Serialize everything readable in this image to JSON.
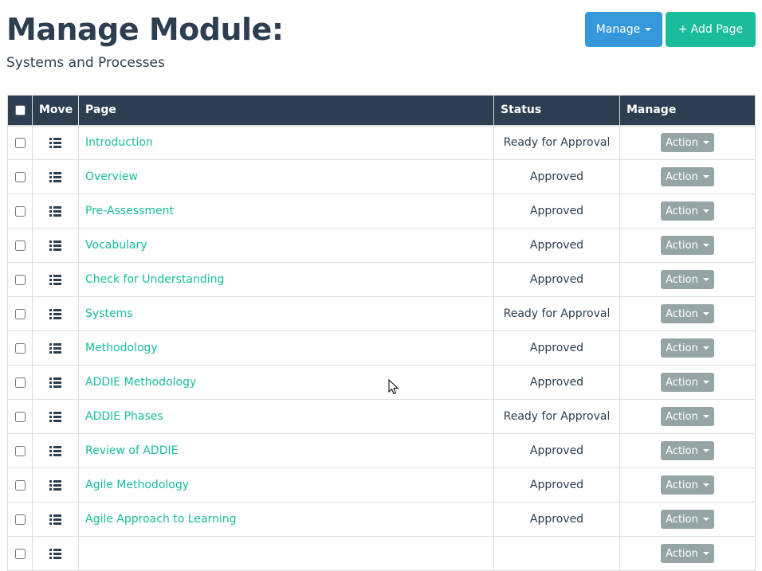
{
  "header": {
    "title": "Manage Module:",
    "subtitle": "Systems and Processes"
  },
  "toolbar": {
    "manage_label": "Manage",
    "add_page_icon": "+",
    "add_page_label": "Add Page"
  },
  "table": {
    "columns": [
      "",
      "Move",
      "Page",
      "Status",
      "Manage"
    ],
    "action_label": "Action",
    "rows": [
      {
        "page": "Introduction",
        "status": "Ready for Approval"
      },
      {
        "page": "Overview",
        "status": "Approved"
      },
      {
        "page": "Pre-Assessment",
        "status": "Approved"
      },
      {
        "page": "Vocabulary",
        "status": "Approved"
      },
      {
        "page": "Check for Understanding",
        "status": "Approved"
      },
      {
        "page": "Systems",
        "status": "Ready for Approval"
      },
      {
        "page": "Methodology",
        "status": "Approved"
      },
      {
        "page": "ADDIE Methodology",
        "status": "Approved"
      },
      {
        "page": "ADDIE Phases",
        "status": "Ready for Approval"
      },
      {
        "page": "Review of ADDIE",
        "status": "Approved"
      },
      {
        "page": "Agile Methodology",
        "status": "Approved"
      },
      {
        "page": "Agile Approach to Learning",
        "status": "Approved"
      },
      {
        "page": "",
        "status": ""
      }
    ]
  },
  "colors": {
    "primary": "#2c3e50",
    "info": "#3498db",
    "success": "#1abc9c",
    "link": "#18bc9c",
    "muted_button": "#95a5a6"
  },
  "icons": {
    "move_handle": "list-icon",
    "caret": "caret-down-icon",
    "cursor": "mouse-pointer-icon"
  }
}
